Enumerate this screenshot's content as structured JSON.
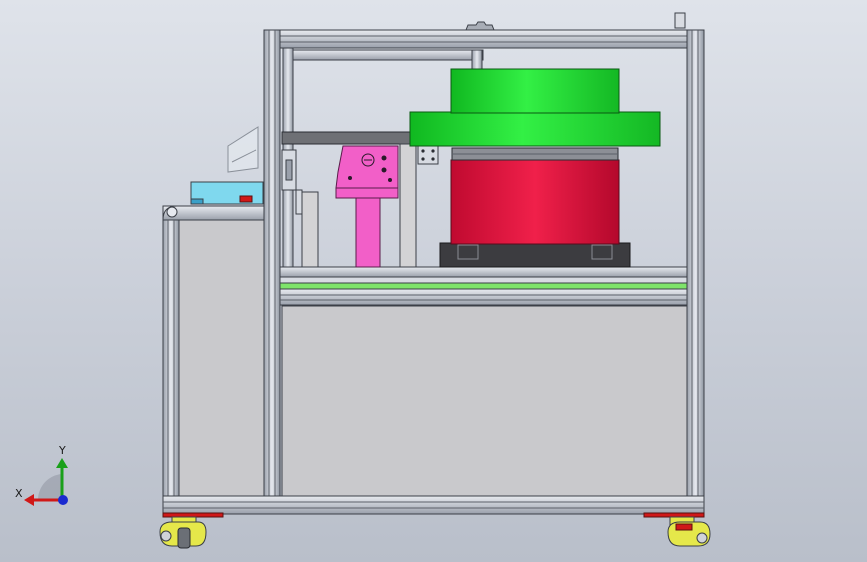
{
  "viewport": {
    "background_top": "#dfe3ea",
    "background_bottom": "#b9bfca"
  },
  "triad": {
    "x_label": "X",
    "y_label": "Y",
    "x_color": "#d01818",
    "y_color": "#1aa01a",
    "z_color": "#1a2ad0"
  },
  "colors": {
    "frame": "#c7ccd6",
    "frame_edge": "#3b3f47",
    "panel": "#c9c9cc",
    "bowl_top": "#22dd33",
    "bowl_body": "#e0103c",
    "bowl_base": "#3c3c40",
    "bracket": "#f25fc8",
    "control_box": "#7fd8ee",
    "green_rail": "#7ee46a"
  }
}
